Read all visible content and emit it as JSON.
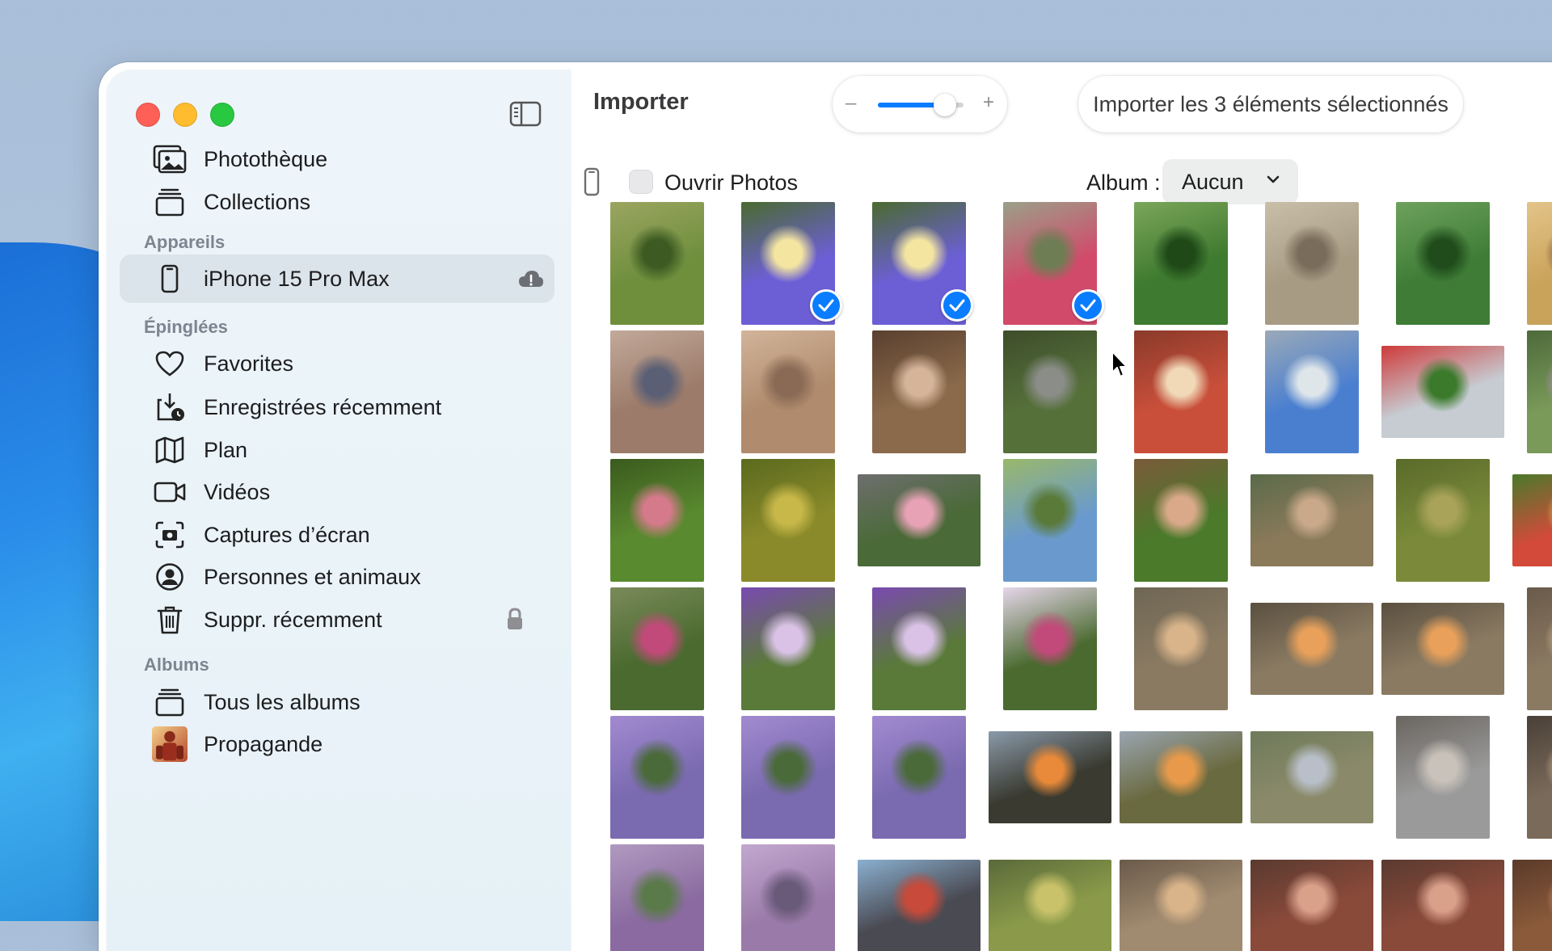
{
  "window": {
    "title": "Importer"
  },
  "sidebar": {
    "library": [
      {
        "label": "Photothèque",
        "icon": "photo-library-icon"
      },
      {
        "label": "Collections",
        "icon": "collections-icon"
      }
    ],
    "devices_header": "Appareils",
    "devices": [
      {
        "label": "iPhone 15 Pro Max",
        "icon": "iphone-icon",
        "selected": true,
        "trailing_icon": "icloud-icon"
      }
    ],
    "pinned_header": "Épinglées",
    "pinned": [
      {
        "label": "Favorites",
        "icon": "heart-icon"
      },
      {
        "label": "Enregistrées récemment",
        "icon": "recently-saved-icon"
      },
      {
        "label": "Plan",
        "icon": "map-icon"
      },
      {
        "label": "Vidéos",
        "icon": "video-icon"
      },
      {
        "label": "Captures d’écran",
        "icon": "screenshot-icon"
      },
      {
        "label": "Personnes et animaux",
        "icon": "person-icon"
      },
      {
        "label": "Suppr. récemment",
        "icon": "trash-icon",
        "trailing_icon": "lock-icon"
      }
    ],
    "albums_header": "Albums",
    "albums": [
      {
        "label": "Tous les albums",
        "icon": "albums-icon"
      },
      {
        "label": "Propagande",
        "icon": "album-thumbnail"
      }
    ]
  },
  "toolbar": {
    "zoom_minus": "–",
    "zoom_plus": "+",
    "zoom_level": 0.78,
    "import_button": "Importer les 3 éléments sélectionnés"
  },
  "options": {
    "open_photos_label": "Ouvrir Photos",
    "open_photos_checked": false,
    "album_label": "Album :",
    "album_value": "Aucun"
  },
  "grid": {
    "selected_count": 3,
    "photos": [
      {
        "o": "p",
        "c": [
          "#6f8f3d",
          "#3d5a22",
          "#9ba560"
        ],
        "s": false
      },
      {
        "o": "p",
        "c": [
          "#6c5fd6",
          "#f4e6a1",
          "#4a6a2f"
        ],
        "s": true
      },
      {
        "o": "p",
        "c": [
          "#6c5fd6",
          "#f4e6a1",
          "#4a6a2f"
        ],
        "s": true
      },
      {
        "o": "p",
        "c": [
          "#d24a6a",
          "#6f7d54",
          "#9aa08a"
        ],
        "s": true
      },
      {
        "o": "p",
        "c": [
          "#3e7a2f",
          "#1f4a18",
          "#7ba65a"
        ],
        "s": false
      },
      {
        "o": "p",
        "c": [
          "#a79b84",
          "#7a6c5a",
          "#c9bfa8"
        ],
        "s": false
      },
      {
        "o": "p",
        "c": [
          "#3f7d36",
          "#204c1c",
          "#6da15c"
        ],
        "s": false
      },
      {
        "o": "p",
        "c": [
          "#c9a35a",
          "#7f5a38",
          "#e3c489"
        ],
        "s": false
      },
      {
        "o": "p",
        "c": [
          "#9c7b6a",
          "#5a5f75",
          "#c2a99a"
        ],
        "s": false
      },
      {
        "o": "p",
        "c": [
          "#b08b6d",
          "#8a6a55",
          "#d2b49a"
        ],
        "s": false
      },
      {
        "o": "p",
        "c": [
          "#8a6a4a",
          "#d6b49a",
          "#5a4030"
        ],
        "s": false
      },
      {
        "o": "p",
        "c": [
          "#56703a",
          "#8a8d88",
          "#3d4d2a"
        ],
        "s": false
      },
      {
        "o": "p",
        "c": [
          "#c94f3a",
          "#f1d9b8",
          "#8a3a2a"
        ],
        "s": false
      },
      {
        "o": "p",
        "c": [
          "#4a7fd0",
          "#dfe6ea",
          "#9aa9b8"
        ],
        "s": false
      },
      {
        "o": "l",
        "c": [
          "#c6ccd2",
          "#3a7a2a",
          "#cf3a3a"
        ],
        "s": false
      },
      {
        "o": "p",
        "c": [
          "#7a9a5a",
          "#b48ac0",
          "#4d6a3a"
        ],
        "s": false
      },
      {
        "o": "p",
        "c": [
          "#5a8a2f",
          "#d47a8a",
          "#3b5a1e"
        ],
        "s": false
      },
      {
        "o": "p",
        "c": [
          "#8a8a2a",
          "#c8b84a",
          "#5a6a1e"
        ],
        "s": false
      },
      {
        "o": "l",
        "c": [
          "#4a6a38",
          "#e8a2b6",
          "#6e6e6e"
        ],
        "s": false
      },
      {
        "o": "p",
        "c": [
          "#6a9acd",
          "#5a7a3a",
          "#9ab86a"
        ],
        "s": false
      },
      {
        "o": "p",
        "c": [
          "#4a7a2a",
          "#d9a98a",
          "#7a5a3a"
        ],
        "s": false
      },
      {
        "o": "l",
        "c": [
          "#8a7a5a",
          "#c9a98a",
          "#5a6a4a"
        ],
        "s": false
      },
      {
        "o": "p",
        "c": [
          "#7a8a3a",
          "#a9a35a",
          "#5a6a2a"
        ],
        "s": false
      },
      {
        "o": "l",
        "c": [
          "#d34a3a",
          "#e8b84a",
          "#4a7a2a"
        ],
        "s": false
      },
      {
        "o": "p",
        "c": [
          "#4a6a2f",
          "#c24a7a",
          "#7a8a5a"
        ],
        "s": false
      },
      {
        "o": "p",
        "c": [
          "#5a7a3a",
          "#d9c2e6",
          "#7a4ab0"
        ],
        "s": false
      },
      {
        "o": "p",
        "c": [
          "#5a7a3a",
          "#d9c2e6",
          "#7a4ab0"
        ],
        "s": false
      },
      {
        "o": "p",
        "c": [
          "#4a6a2f",
          "#c24a7a",
          "#e6d6ea"
        ],
        "s": false
      },
      {
        "o": "p",
        "c": [
          "#8a7a62",
          "#d9b48a",
          "#6e6654"
        ],
        "s": false
      },
      {
        "o": "l",
        "c": [
          "#8a7a62",
          "#e8a05a",
          "#5a5040"
        ],
        "s": false
      },
      {
        "o": "l",
        "c": [
          "#8a7a62",
          "#e8a05a",
          "#5a5040"
        ],
        "s": false
      },
      {
        "o": "p",
        "c": [
          "#8a7a62",
          "#c9b08a",
          "#6a5a4a"
        ],
        "s": false
      },
      {
        "o": "p",
        "c": [
          "#7a6ab0",
          "#4a6a3a",
          "#a28ad0"
        ],
        "s": false
      },
      {
        "o": "p",
        "c": [
          "#7a6ab0",
          "#4a6a3a",
          "#a28ad0"
        ],
        "s": false
      },
      {
        "o": "p",
        "c": [
          "#7a6ab0",
          "#4a6a3a",
          "#a28ad0"
        ],
        "s": false
      },
      {
        "o": "l",
        "c": [
          "#3a3a30",
          "#e88a3a",
          "#8a9aaa"
        ],
        "s": false
      },
      {
        "o": "l",
        "c": [
          "#6a6a40",
          "#e89a4a",
          "#9aa5b0"
        ],
        "s": false
      },
      {
        "o": "l",
        "c": [
          "#8a8a6a",
          "#b8bfc8",
          "#6e7a5a"
        ],
        "s": false
      },
      {
        "o": "p",
        "c": [
          "#9a9a9a",
          "#c9c2ba",
          "#6a6560"
        ],
        "s": false
      },
      {
        "o": "p",
        "c": [
          "#7a6a5a",
          "#c9a88a",
          "#4a4038"
        ],
        "s": false
      },
      {
        "o": "p",
        "c": [
          "#8a6aa0",
          "#5a7a4a",
          "#b09ac0"
        ],
        "s": false
      },
      {
        "o": "p",
        "c": [
          "#9a7aa8",
          "#6a5a7a",
          "#c2a8d0"
        ],
        "s": false
      },
      {
        "o": "l",
        "c": [
          "#4a4a52",
          "#c84a3a",
          "#8ab0d0"
        ],
        "s": false
      },
      {
        "o": "l",
        "c": [
          "#8a9a4a",
          "#c9c26a",
          "#5a6a3a"
        ],
        "s": false
      },
      {
        "o": "l",
        "c": [
          "#a08a70",
          "#d9b48a",
          "#6a5a4a"
        ],
        "s": false
      },
      {
        "o": "l",
        "c": [
          "#8a4a3a",
          "#d9a08a",
          "#5a3a30"
        ],
        "s": false
      },
      {
        "o": "l",
        "c": [
          "#8a4a3a",
          "#d9a08a",
          "#5a3a30"
        ],
        "s": false
      },
      {
        "o": "l",
        "c": [
          "#8a5a3a",
          "#c98a6a",
          "#5a3a2a"
        ],
        "s": false
      }
    ]
  }
}
